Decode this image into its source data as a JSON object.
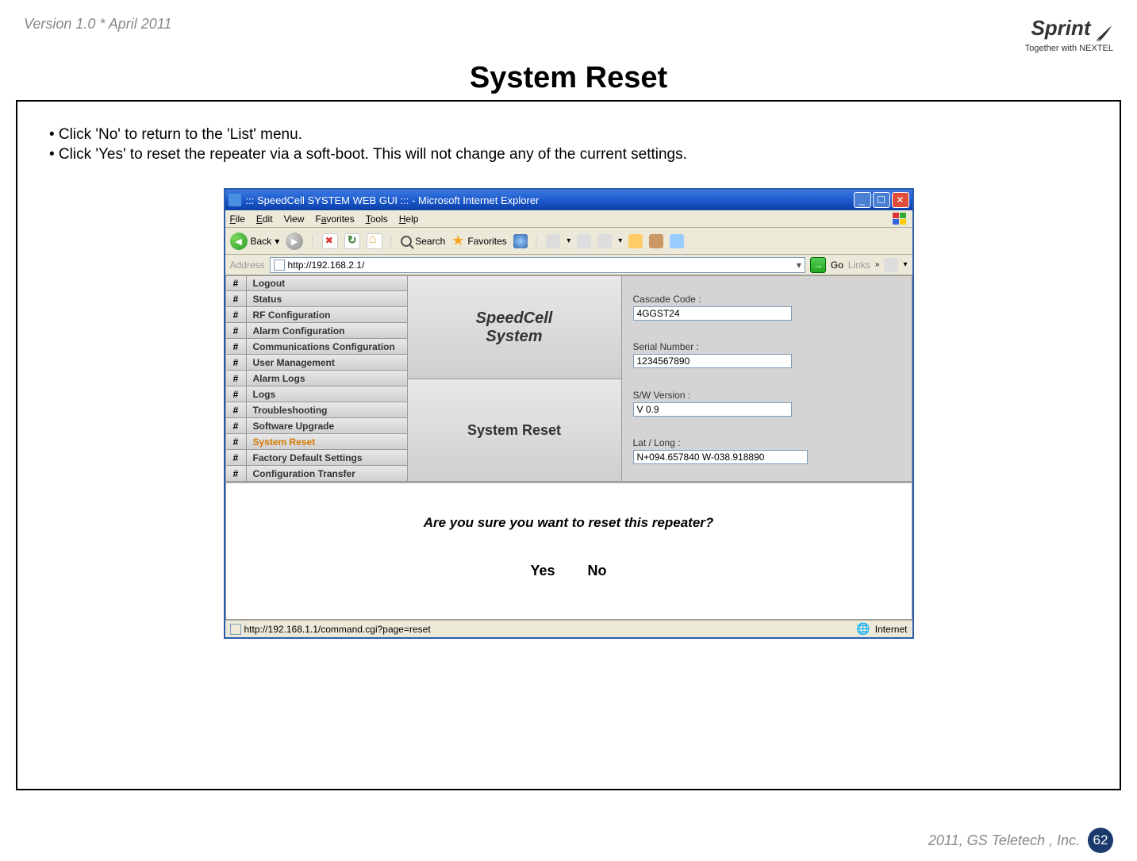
{
  "header": {
    "version": "Version 1.0 * April 2011",
    "brand": "Sprint",
    "tagline": "Together with NEXTEL"
  },
  "title": "System Reset",
  "bullets": [
    "• Click 'No' to return to the 'List' menu.",
    "• Click 'Yes' to reset the repeater via a soft-boot. This will not change any of the current settings."
  ],
  "ie": {
    "title": "::: SpeedCell SYSTEM WEB GUI ::: - Microsoft Internet Explorer",
    "menu": {
      "file": "File",
      "edit": "Edit",
      "view": "View",
      "favorites": "Favorites",
      "tools": "Tools",
      "help": "Help"
    },
    "toolbar": {
      "back": "Back",
      "search": "Search",
      "favorites": "Favorites"
    },
    "address_label": "Address",
    "url": "http://192.168.2.1/",
    "go": "Go",
    "links": "Links",
    "status_url": "http://192.168.1.1/command.cgi?page=reset",
    "status_zone": "Internet"
  },
  "gui": {
    "nav": [
      "Logout",
      "Status",
      "RF Configuration",
      "Alarm Configuration",
      "Communications Configuration",
      "User Management",
      "Alarm Logs",
      "Logs",
      "Troubleshooting",
      "Software Upgrade",
      "System Reset",
      "Factory Default Settings",
      "Configuration Transfer"
    ],
    "nav_active_index": 10,
    "center_top": "SpeedCell System",
    "center_bottom": "System Reset",
    "info": {
      "cascade_label": "Cascade Code :",
      "cascade_value": "4GGST24",
      "serial_label": "Serial Number :",
      "serial_value": "1234567890",
      "sw_label": "S/W Version :",
      "sw_value": "V 0.9",
      "latlong_label": "Lat / Long :",
      "latlong_value": "N+094.657840 W-038.918890"
    },
    "prompt": "Are you sure you want to reset this repeater?",
    "yes": "Yes",
    "no": "No"
  },
  "footer": {
    "copyright": "2011, GS Teletech , Inc.",
    "page": "62"
  }
}
